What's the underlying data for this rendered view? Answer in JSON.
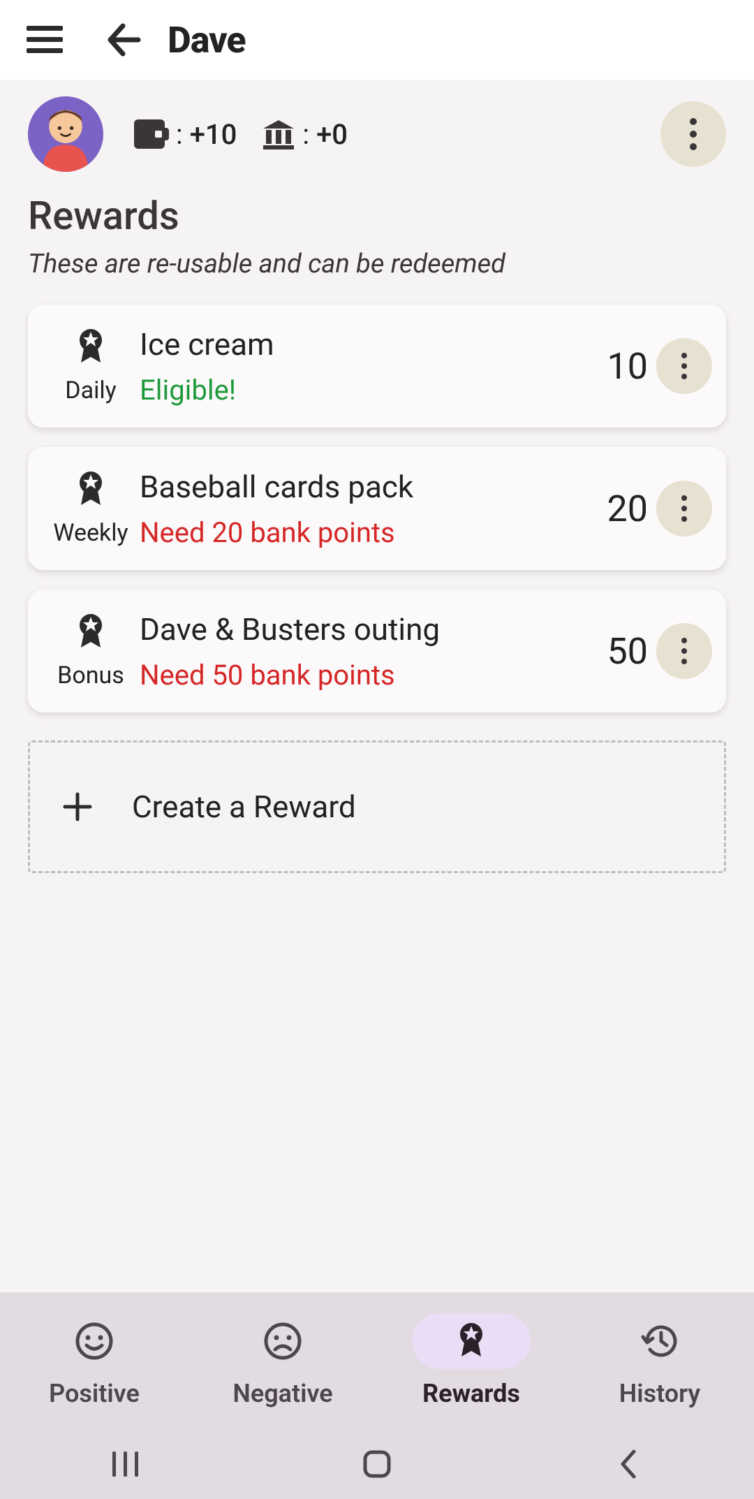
{
  "appbar": {
    "title": "Dave"
  },
  "profile": {
    "wallet": {
      "label": ":",
      "value": "+10"
    },
    "bank": {
      "label": ":",
      "value": "+0"
    }
  },
  "section": {
    "heading": "Rewards",
    "subtitle": "These are re-usable and can be redeemed"
  },
  "rewards": [
    {
      "freq": "Daily",
      "title": "Ice cream",
      "status": "Eligible!",
      "status_type": "ok",
      "points": "10"
    },
    {
      "freq": "Weekly",
      "title": "Baseball cards pack",
      "status": "Need 20 bank points",
      "status_type": "need",
      "points": "20"
    },
    {
      "freq": "Bonus",
      "title": "Dave & Busters outing",
      "status": "Need 50 bank points",
      "status_type": "need",
      "points": "50"
    }
  ],
  "create": {
    "label": "Create a Reward"
  },
  "tabs": [
    {
      "id": "positive",
      "label": "Positive",
      "active": false
    },
    {
      "id": "negative",
      "label": "Negative",
      "active": false
    },
    {
      "id": "rewards",
      "label": "Rewards",
      "active": true
    },
    {
      "id": "history",
      "label": "History",
      "active": false
    }
  ]
}
